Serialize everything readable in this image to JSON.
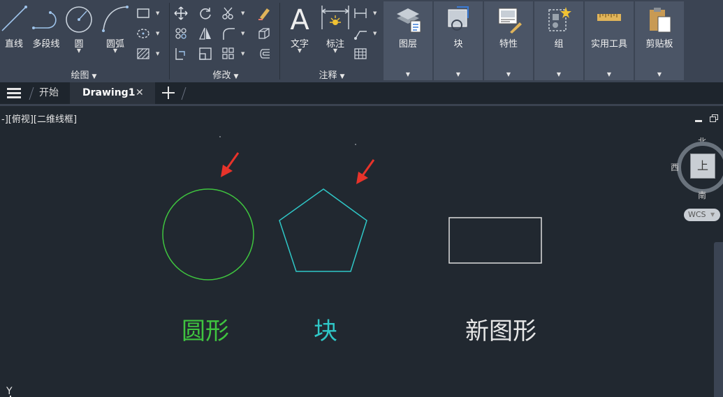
{
  "ribbon": {
    "draw": {
      "title": "绘图",
      "line": "直线",
      "polyline": "多段线",
      "circle": "圆",
      "arc": "圆弧"
    },
    "modify": {
      "title": "修改"
    },
    "annotate": {
      "title": "注释",
      "text": "文字",
      "dimension": "标注"
    },
    "tiles": {
      "layers": "图层",
      "block": "块",
      "properties": "特性",
      "group": "组",
      "utilities": "实用工具",
      "clipboard": "剪贴板"
    }
  },
  "tabs": {
    "start": "开始",
    "drawing": "Drawing1"
  },
  "viewport": {
    "label": "-][俯视][二维线框]"
  },
  "viewcube": {
    "north": "北",
    "south": "南",
    "west": "西",
    "top": "上",
    "wcs": "WCS"
  },
  "shapes": {
    "circle_label": "圆形",
    "block_label": "块",
    "newshape_label": "新图形",
    "circle_color": "#3fc43f",
    "pentagon_color": "#2fc7c7",
    "rect_color": "#dddddd",
    "arrow_color": "#e8332a"
  },
  "ucs": {
    "y": "Y"
  }
}
